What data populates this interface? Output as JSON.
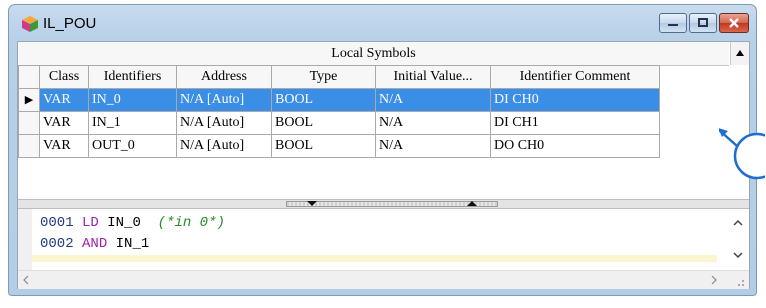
{
  "window": {
    "title": "IL_POU"
  },
  "symbols": {
    "caption": "Local Symbols",
    "columns": [
      "Class",
      "Identifiers",
      "Address",
      "Type",
      "Initial Value...",
      "Identifier Comment"
    ],
    "rows": [
      {
        "class": "VAR",
        "identifier": "IN_0",
        "address": "N/A [Auto]",
        "type": "BOOL",
        "initial": "N/A",
        "comment": "DI CH0"
      },
      {
        "class": "VAR",
        "identifier": "IN_1",
        "address": "N/A [Auto]",
        "type": "BOOL",
        "initial": "N/A",
        "comment": "DI CH1"
      },
      {
        "class": "VAR",
        "identifier": "OUT_0",
        "address": "N/A [Auto]",
        "type": "BOOL",
        "initial": "N/A",
        "comment": "DO CH0"
      }
    ],
    "selected_row": 0
  },
  "editor": {
    "lines": [
      {
        "num": "0001",
        "op": "LD",
        "operand": "IN_0",
        "comment": "(*in 0*)"
      },
      {
        "num": "0002",
        "op": "AND",
        "operand": "IN_1",
        "comment": ""
      }
    ]
  },
  "colors": {
    "selection": "#3a8ee6",
    "keyword": "#a01fb0",
    "comment": "#2a8b2a",
    "callout": "#1f6fd1"
  }
}
